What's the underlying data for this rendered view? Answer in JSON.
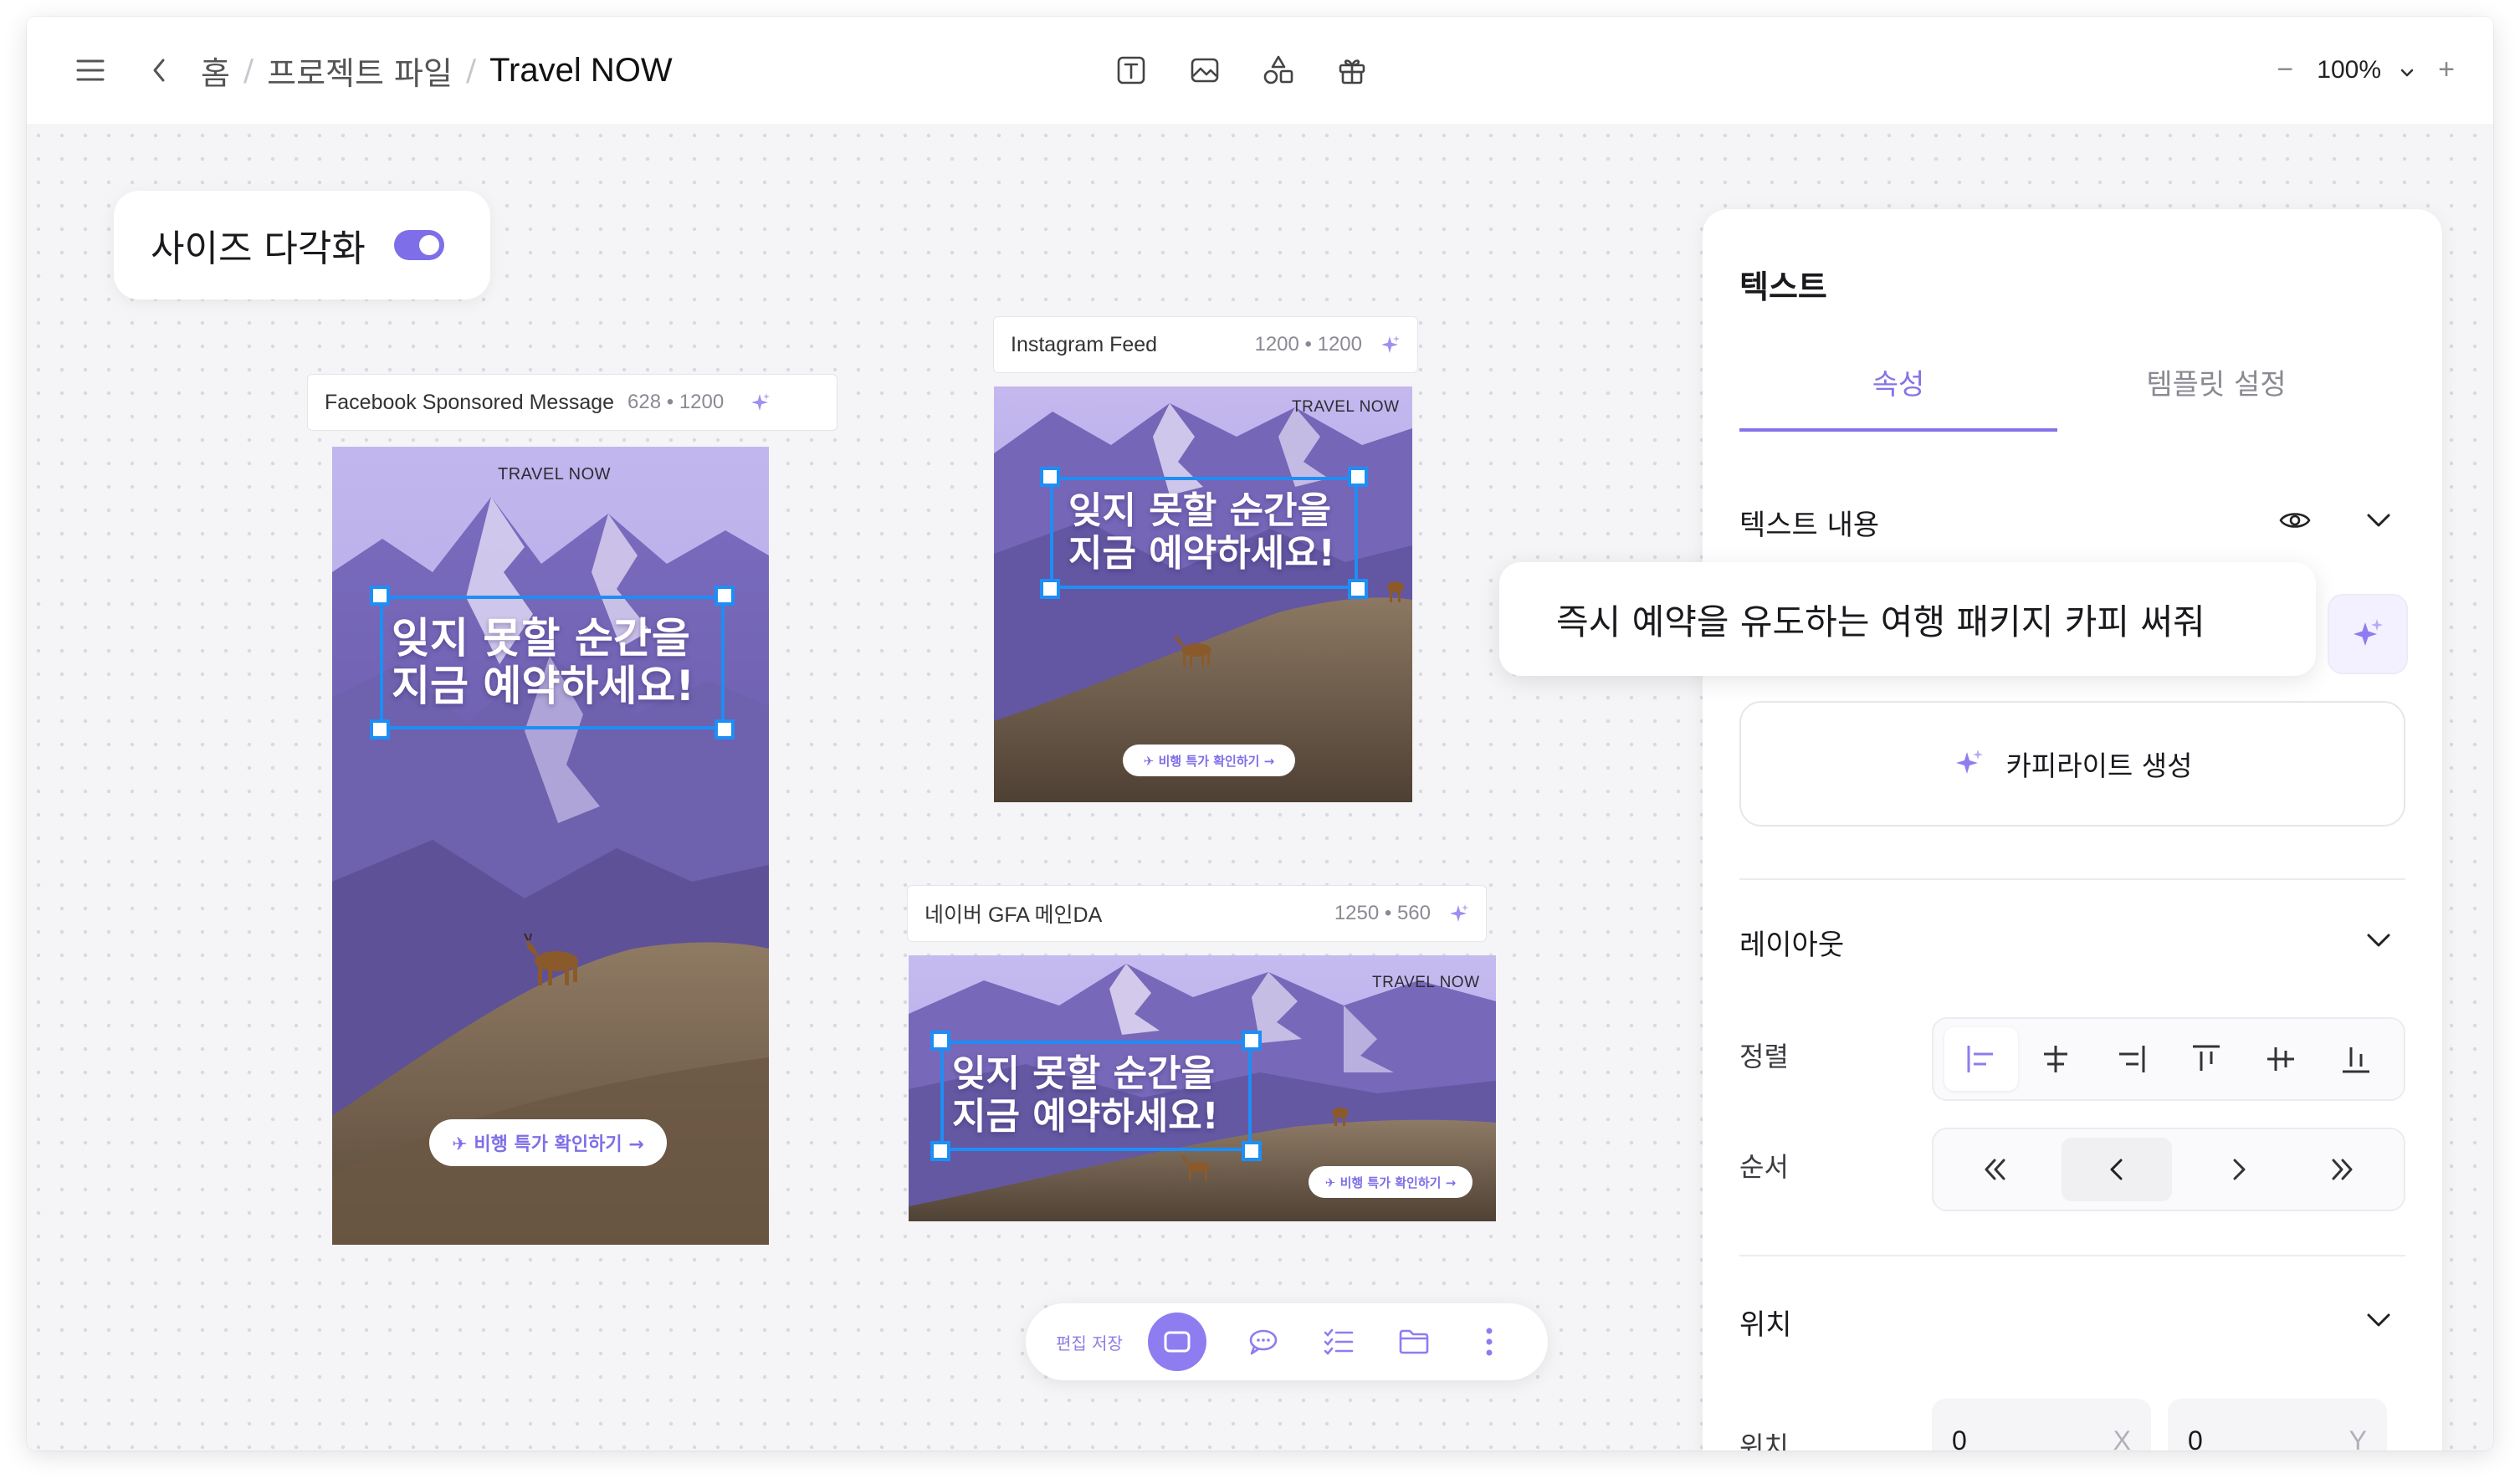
{
  "topbar": {
    "breadcrumbs": [
      "홈",
      "프로젝트 파일",
      "Travel NOW"
    ],
    "tools": [
      "text-tool-icon",
      "image-tool-icon",
      "shapes-tool-icon",
      "gift-tool-icon"
    ],
    "zoom_level": "100%",
    "zoom_out": "−",
    "zoom_in": "+"
  },
  "size_card": {
    "label": "사이즈 다각화",
    "toggle_on": true
  },
  "frames": [
    {
      "name": "Facebook Sponsored Message",
      "size": "628 • 1200",
      "brand": "TRAVEL NOW",
      "headline_1": "잊지 못할 순간을",
      "headline_2": "지금 예약하세요!",
      "cta": "✈ 비행 특가 확인하기 →"
    },
    {
      "name": "Instagram Feed",
      "size": "1200 • 1200",
      "brand": "TRAVEL NOW",
      "headline_1": "잊지 못할 순간을",
      "headline_2": "지금 예약하세요!",
      "cta": "✈ 비행 특가 확인하기 →"
    },
    {
      "name": "네이버 GFA  메인DA",
      "size": "1250 • 560",
      "brand": "TRAVEL NOW",
      "headline_1": "잊지 못할 순간을",
      "headline_2": "지금 예약하세요!",
      "cta": "✈ 비행 특가 확인하기 →"
    }
  ],
  "bottom_toolbar": {
    "save_label": "편집 저장"
  },
  "panel": {
    "title": "텍스트",
    "tabs": [
      "속성",
      "템플릿 설정"
    ],
    "active_tab": "속성",
    "text_content_label": "텍스트 내용",
    "prompt_text": "즉시 예약을 유도하는 여행 패키지 카피 써줘",
    "generate_label": "카피라이트 생성",
    "layout_label": "레이아웃",
    "align_label": "정렬",
    "order_label": "순서",
    "position_section": "위치",
    "position_label": "위치",
    "x_value": "0",
    "x_axis": "X",
    "y_value": "0",
    "y_axis": "Y"
  },
  "colors": {
    "accent": "#8474e8",
    "selection": "#1e8ef5"
  }
}
